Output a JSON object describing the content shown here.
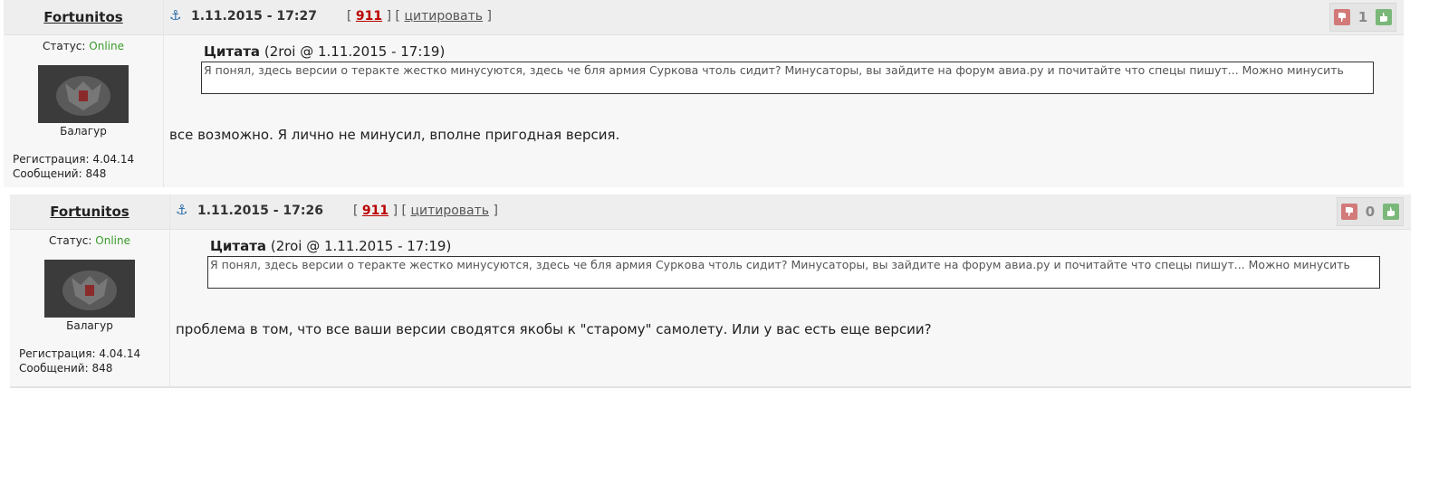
{
  "posts": [
    {
      "username": "Fortunitos",
      "status_label": "Статус:",
      "status_value": "Online",
      "rank": "Балагур",
      "registration": "Регистрация: 4.04.14",
      "messages": "Сообщений: 848",
      "datetime": "1.11.2015 - 17:27",
      "link_open": "[",
      "number": "911",
      "link_mid": "] [",
      "quote_link": "цитировать",
      "link_close": "]",
      "score": "1",
      "quote_label": "Цитата",
      "quote_meta": "(2roi @ 1.11.2015 - 17:19)",
      "quote_text": "Я понял, здесь версии о теракте жестко минусуются, здесь че бля армия Суркова чтоль сидит? Минусаторы, вы зайдите на форум авиа.ру и почитайте что спецы пишут... Можно минусить",
      "text": "все возможно. Я лично не минусил, вполне пригодная версия."
    },
    {
      "username": "Fortunitos",
      "status_label": "Статус:",
      "status_value": "Online",
      "rank": "Балагур",
      "registration": "Регистрация: 4.04.14",
      "messages": "Сообщений: 848",
      "datetime": "1.11.2015 - 17:26",
      "link_open": "[",
      "number": "911",
      "link_mid": "] [",
      "quote_link": "цитировать",
      "link_close": "]",
      "score": "0",
      "quote_label": "Цитата",
      "quote_meta": "(2roi @ 1.11.2015 - 17:19)",
      "quote_text": "Я понял, здесь версии о теракте жестко минусуются, здесь че бля армия Суркова чтоль сидит? Минусаторы, вы зайдите на форум авиа.ру и почитайте что спецы пишут... Можно минусить",
      "text": "проблема в том, что все ваши версии сводятся якобы к \"старому\" самолету. Или у вас есть еще версии?"
    }
  ],
  "icons": {
    "anchor": "anchor-icon",
    "downvote": "thumbs-down-icon",
    "upvote": "thumbs-up-icon",
    "avatar": "coat-of-arms-emblem"
  },
  "colors": {
    "online": "#3a9a2a",
    "post_number": "#bb0000",
    "anchor": "#2a6aa8",
    "downvote": "#d27a7a",
    "upvote": "#7ab87a"
  }
}
